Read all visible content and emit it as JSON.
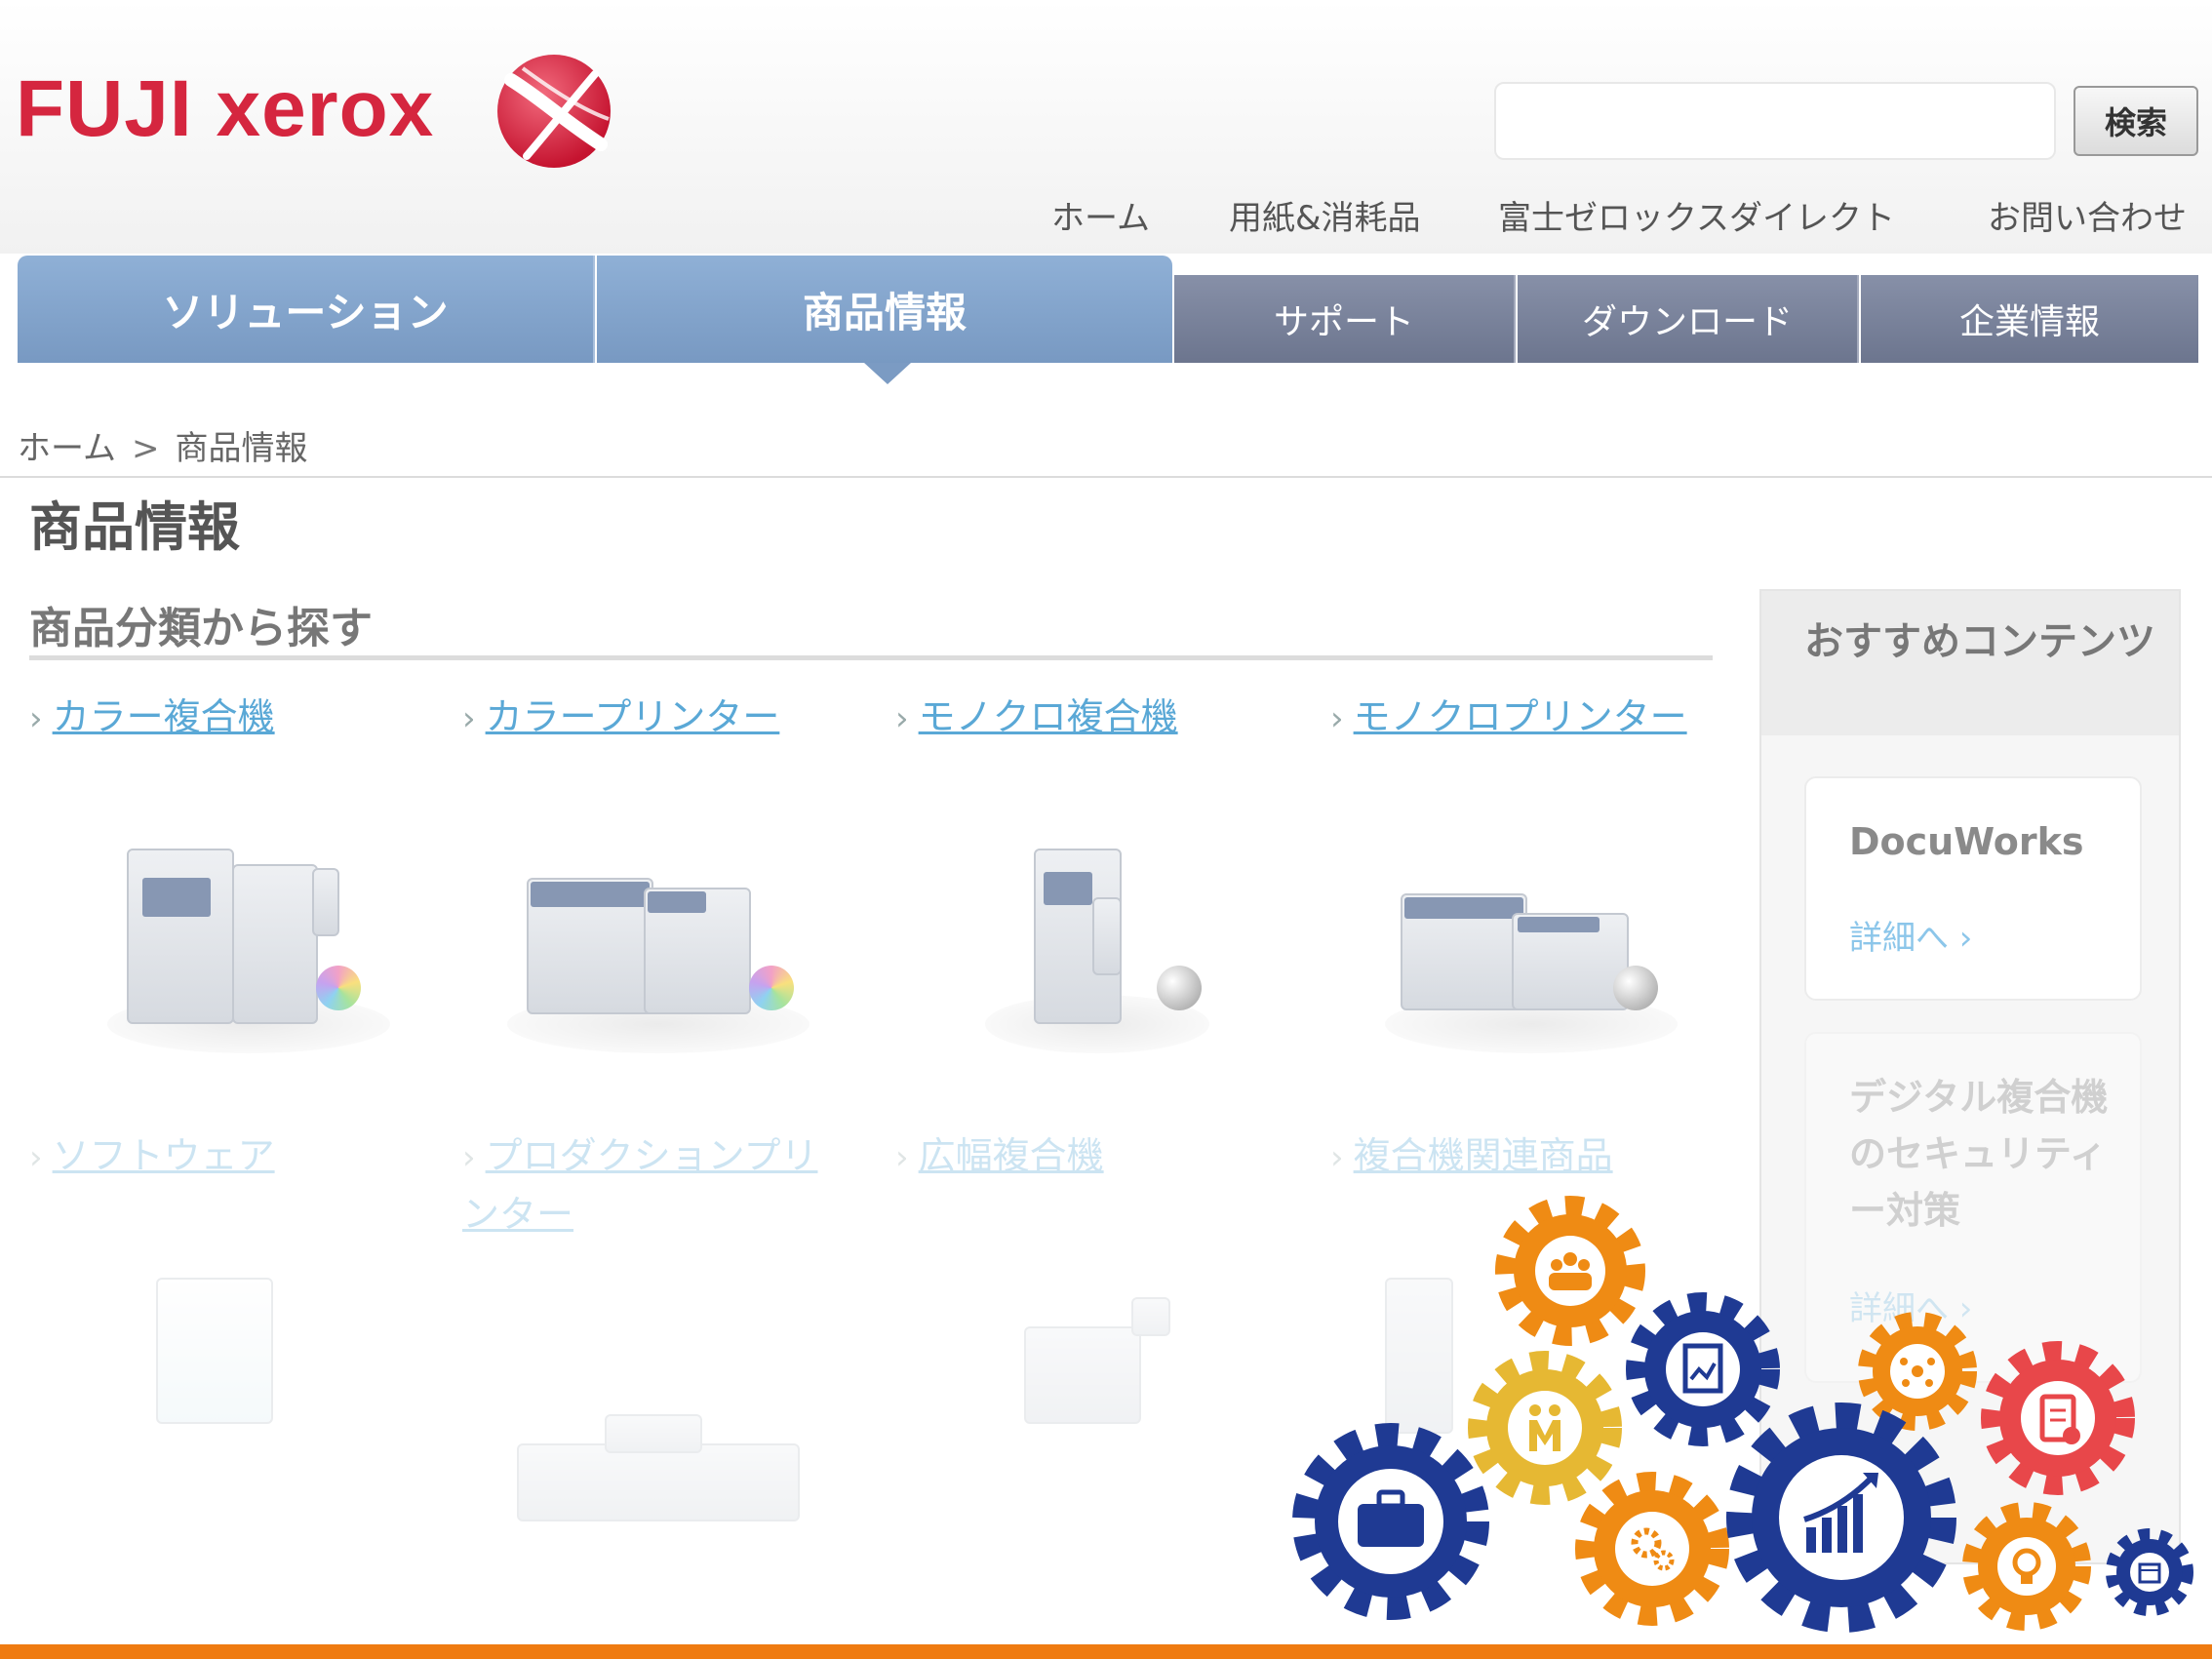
{
  "brand": {
    "name": "FUJI xerox",
    "primary_color": "#d5263f"
  },
  "search": {
    "placeholder": "",
    "button_label": "検索"
  },
  "utility_nav": [
    "ホーム",
    "用紙&消耗品",
    "富士ゼロックスダイレクト",
    "お問い合わせ"
  ],
  "main_nav": {
    "primary": [
      "ソリューション",
      "商品情報"
    ],
    "secondary": [
      "サポート",
      "ダウンロード",
      "企業情報"
    ],
    "active": "商品情報"
  },
  "breadcrumb": {
    "home": "ホーム",
    "separator": ">",
    "current": "商品情報"
  },
  "page": {
    "title": "商品情報",
    "section_title": "商品分類から探す"
  },
  "categories": [
    {
      "label": "カラー複合機",
      "icon": "color-mfp"
    },
    {
      "label": "カラープリンター",
      "icon": "color-printer"
    },
    {
      "label": "モノクロ複合機",
      "icon": "mono-mfp"
    },
    {
      "label": "モノクロプリンター",
      "icon": "mono-printer"
    },
    {
      "label": "ソフトウェア",
      "icon": "software-box"
    },
    {
      "label": "プロダクションプリンター",
      "icon": "production-printer"
    },
    {
      "label": "広幅複合機",
      "icon": "wide-format-mfp"
    },
    {
      "label": "複合機関連商品",
      "icon": "mfp-accessory"
    }
  ],
  "sidebar": {
    "title": "おすすめコンテンツ",
    "cards": [
      {
        "title": "DocuWorks",
        "link": "詳細へ"
      },
      {
        "title": "デジタル複合機のセキュリティー対策",
        "link": "詳細へ"
      }
    ]
  },
  "overlay": {
    "gear_icons": [
      "people-gear-icon",
      "document-chart-gear-icon",
      "handshake-gear-icon",
      "network-gear-icon",
      "clipboard-check-gear-icon",
      "briefcase-gear-icon",
      "settings-gear-icon",
      "growth-chart-gear-icon",
      "lightbulb-gear-icon",
      "calendar-gear-icon"
    ],
    "colors": {
      "orange": "#ef8b14",
      "navy": "#1f3a93",
      "yellow": "#e6b833",
      "red": "#e8474a"
    }
  },
  "accent_bar_color": "#ef7b11"
}
